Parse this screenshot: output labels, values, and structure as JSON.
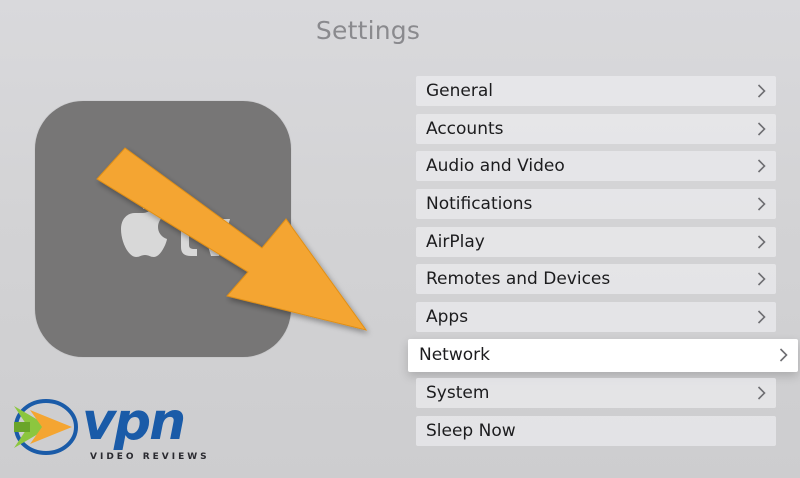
{
  "header": {
    "title": "Settings"
  },
  "device_tile": {
    "icon": "apple-tv-icon"
  },
  "menu": {
    "items": [
      {
        "label": "General",
        "focused": false
      },
      {
        "label": "Accounts",
        "focused": false
      },
      {
        "label": "Audio and Video",
        "focused": false
      },
      {
        "label": "Notifications",
        "focused": false
      },
      {
        "label": "AirPlay",
        "focused": false
      },
      {
        "label": "Remotes and Devices",
        "focused": false
      },
      {
        "label": "Apps",
        "focused": false
      },
      {
        "label": "Network",
        "focused": true
      },
      {
        "label": "System",
        "focused": false
      },
      {
        "label": "Sleep Now",
        "focused": false
      }
    ]
  },
  "annotation": {
    "icon": "arrow-icon",
    "color": "#f4a531"
  },
  "watermark": {
    "brand": "vpn",
    "tagline": "VIDEO REVIEWS",
    "color": "#1a5ba8"
  }
}
